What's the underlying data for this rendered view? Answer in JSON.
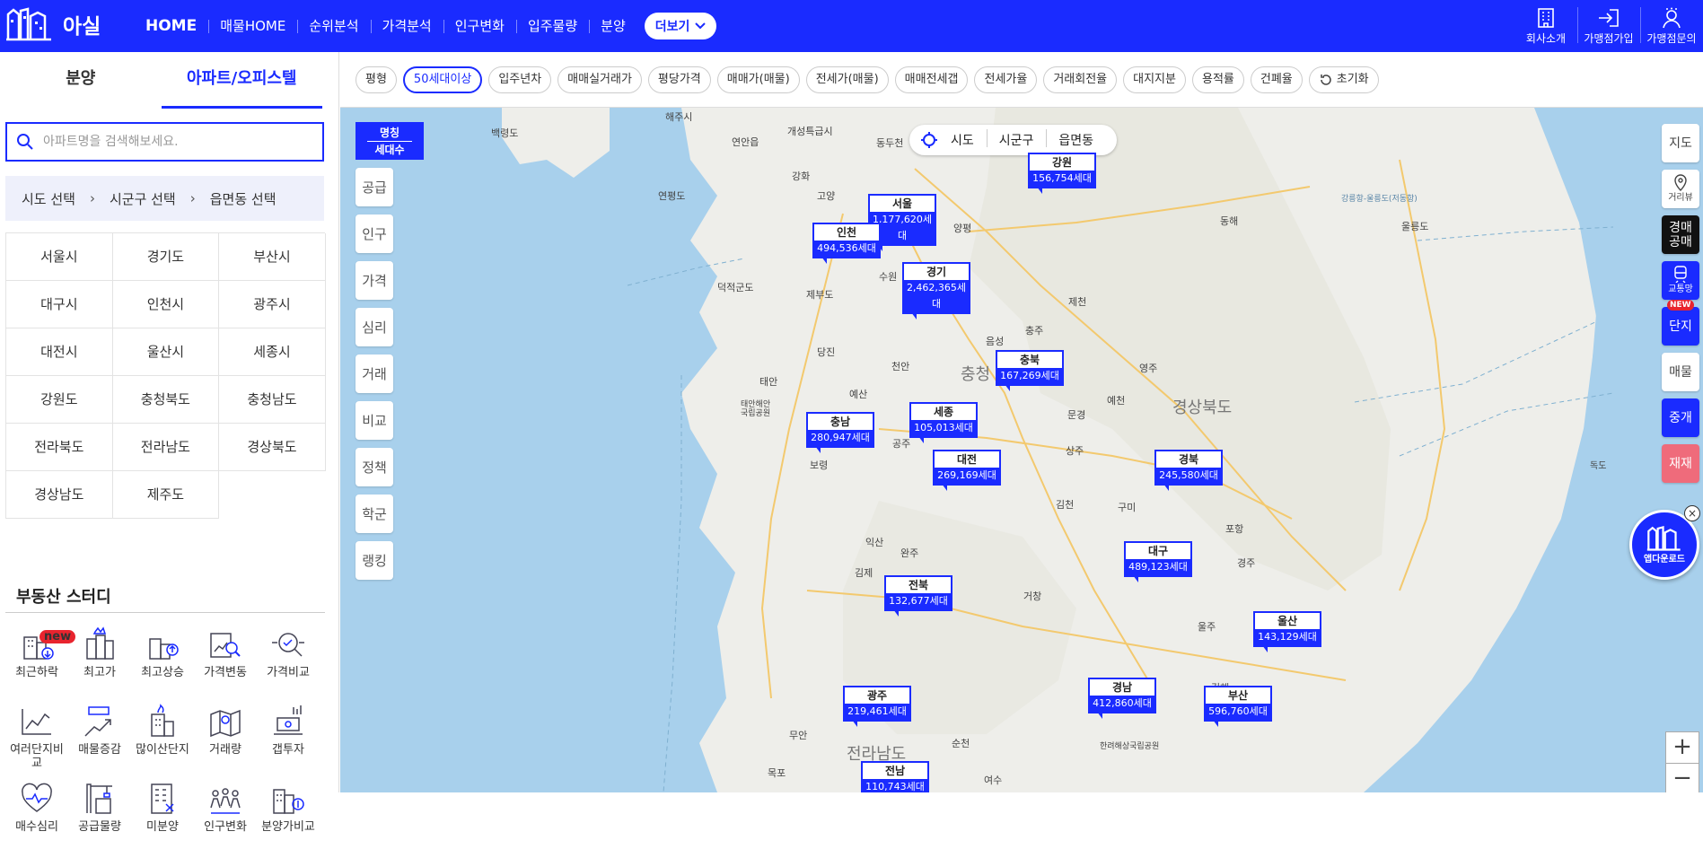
{
  "header": {
    "logo_text": "아실",
    "nav": [
      "HOME",
      "매물HOME",
      "순위분석",
      "가격분석",
      "인구변화",
      "입주물량",
      "분양"
    ],
    "more_label": "더보기",
    "right": [
      "회사소개",
      "가맹점가입",
      "가맹점문의"
    ]
  },
  "sidebar": {
    "tabs": [
      "분양",
      "아파트/오피스텔"
    ],
    "active_tab": "아파트/오피스텔",
    "search_placeholder": "아파트명을 검색해보세요.",
    "region_steps": [
      "시도 선택",
      "시군구 선택",
      "읍면동 선택"
    ],
    "cities": [
      "서울시",
      "경기도",
      "부산시",
      "대구시",
      "인천시",
      "광주시",
      "대전시",
      "울산시",
      "세종시",
      "강원도",
      "충청북도",
      "충청남도",
      "전라북도",
      "전라남도",
      "경상북도",
      "경상남도",
      "제주도"
    ],
    "study_title": "부동산 스터디",
    "study_new": "new",
    "study_items": [
      "최근하락",
      "최고가",
      "최고상승",
      "가격변동",
      "가격비교",
      "여러단지비교",
      "매물증감",
      "많이산단지",
      "거래량",
      "갭투자",
      "매수심리",
      "공급물량",
      "미분양",
      "인구변화",
      "분양가비교"
    ]
  },
  "filters": {
    "chips": [
      "평형",
      "50세대이상",
      "입주년차",
      "매매실거래가",
      "평당가격",
      "매매가(매물)",
      "전세가(매물)",
      "매매전세갭",
      "전세가율",
      "거래회전율",
      "대지지분",
      "용적률",
      "건폐율",
      "초기화"
    ],
    "active": "50세대이상"
  },
  "left_tools": {
    "head_top": "명칭",
    "head_bottom": "세대수",
    "items": [
      "공급",
      "인구",
      "가격",
      "심리",
      "거래",
      "비교",
      "정책",
      "학군",
      "랭킹"
    ]
  },
  "level_selector": [
    "시도",
    "시군구",
    "읍면동"
  ],
  "markers": [
    {
      "name": "강원",
      "value": "156,754세대"
    },
    {
      "name": "서울",
      "value": "1,177,620세대"
    },
    {
      "name": "인천",
      "value": "494,536세대"
    },
    {
      "name": "경기",
      "value": "2,462,365세대"
    },
    {
      "name": "충북",
      "value": "167,269세대"
    },
    {
      "name": "충남",
      "value": "280,947세대"
    },
    {
      "name": "세종",
      "value": "105,013세대"
    },
    {
      "name": "대전",
      "value": "269,169세대"
    },
    {
      "name": "경북",
      "value": "245,580세대"
    },
    {
      "name": "대구",
      "value": "489,123세대"
    },
    {
      "name": "전북",
      "value": "132,677세대"
    },
    {
      "name": "울산",
      "value": "143,129세대"
    },
    {
      "name": "광주",
      "value": "219,461세대"
    },
    {
      "name": "경남",
      "value": "412,860세대"
    },
    {
      "name": "부산",
      "value": "596,760세대"
    },
    {
      "name": "전남",
      "value": "110,743세대"
    }
  ],
  "map_labels": [
    "해주시",
    "연안읍",
    "개성특급시",
    "동두천",
    "백령도",
    "강화",
    "연평도",
    "고양",
    "양평",
    "제부도",
    "덕적군도",
    "수원",
    "제천",
    "충주",
    "음성",
    "당진",
    "태안",
    "태안해안국립공원",
    "천안",
    "예산",
    "충청",
    "영주",
    "예천",
    "문경",
    "경상북도",
    "상주",
    "보령",
    "공주",
    "김천",
    "구미",
    "익산",
    "완주",
    "김제",
    "포항",
    "경주",
    "거창",
    "울주",
    "김해",
    "전라남도",
    "순천",
    "무안",
    "목포",
    "여수",
    "한려해상국립공원",
    "울릉도",
    "동해",
    "강릉항-울릉도(저동항)",
    "독도"
  ],
  "right_tools": {
    "items": [
      "지도",
      "거리뷰",
      "경매공매",
      "교통망",
      "단지",
      "매물",
      "중개",
      "재재"
    ],
    "new_tag": "NEW"
  },
  "app_download": "앱다운로드",
  "zoom": [
    "+",
    "−"
  ],
  "colors": {
    "brand": "#1a2bff",
    "map_water": "#a8d0ec",
    "map_land": "#eeeeea",
    "badge": "#e8242e"
  }
}
